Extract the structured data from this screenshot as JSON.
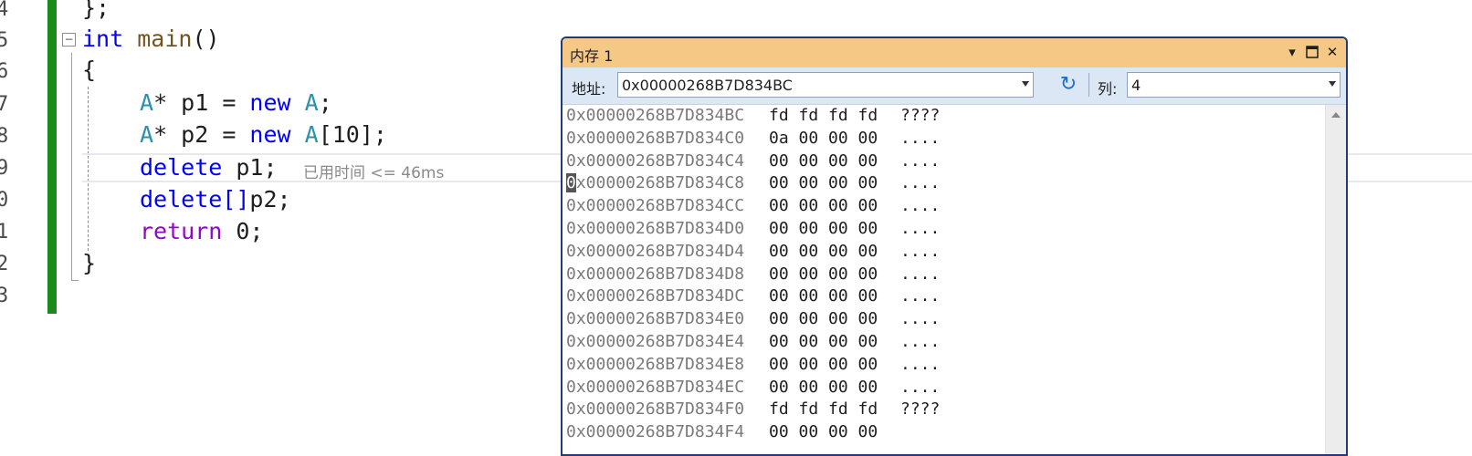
{
  "editor": {
    "line_numbers": [
      "4",
      "5",
      "6",
      "7",
      "8",
      "9",
      "0",
      "1",
      "2",
      "3"
    ],
    "lines": {
      "l4": "};",
      "l5_kw": "int",
      "l5_fn": "main",
      "l5_rest": "()",
      "l6": "{",
      "l7_type": "A",
      "l7_a": "* p1 = ",
      "l7_kw": "new",
      "l7_type2": "A",
      "l7_b": ";",
      "l8_type": "A",
      "l8_a": "* p2 = ",
      "l8_kw": "new",
      "l8_type2": "A",
      "l8_b": "[10];",
      "l9_kw": "delete",
      "l9_rest": " p1;",
      "l10_kw": "delete[]",
      "l10_rest": "p2;",
      "l11_kw": "return",
      "l11_rest": " 0;",
      "l12": "}"
    },
    "perf_tip": "已用时间 <= 46ms"
  },
  "memory_window": {
    "title": "内存 1",
    "address_label": "地址:",
    "address_value": "0x00000268B7D834BC",
    "columns_label": "列:",
    "columns_value": "4",
    "rows": [
      {
        "addr": "0x00000268B7D834BC",
        "bytes": "fd fd fd fd",
        "ascii": "????"
      },
      {
        "addr": "0x00000268B7D834C0",
        "bytes": "0a 00 00 00",
        "ascii": "...."
      },
      {
        "addr": "0x00000268B7D834C4",
        "bytes": "00 00 00 00",
        "ascii": "...."
      },
      {
        "addr": "x00000268B7D834C8",
        "bytes": "00 00 00 00",
        "ascii": "...."
      },
      {
        "addr": "0x00000268B7D834CC",
        "bytes": "00 00 00 00",
        "ascii": "...."
      },
      {
        "addr": "0x00000268B7D834D0",
        "bytes": "00 00 00 00",
        "ascii": "...."
      },
      {
        "addr": "0x00000268B7D834D4",
        "bytes": "00 00 00 00",
        "ascii": "...."
      },
      {
        "addr": "0x00000268B7D834D8",
        "bytes": "00 00 00 00",
        "ascii": "...."
      },
      {
        "addr": "0x00000268B7D834DC",
        "bytes": "00 00 00 00",
        "ascii": "...."
      },
      {
        "addr": "0x00000268B7D834E0",
        "bytes": "00 00 00 00",
        "ascii": "...."
      },
      {
        "addr": "0x00000268B7D834E4",
        "bytes": "00 00 00 00",
        "ascii": "...."
      },
      {
        "addr": "0x00000268B7D834E8",
        "bytes": "00 00 00 00",
        "ascii": "...."
      },
      {
        "addr": "0x00000268B7D834EC",
        "bytes": "00 00 00 00",
        "ascii": "...."
      },
      {
        "addr": "0x00000268B7D834F0",
        "bytes": "fd fd fd fd",
        "ascii": "????"
      },
      {
        "addr": "0x00000268B7D834F4",
        "bytes": "00 00 00 00",
        "ascii": ""
      }
    ],
    "caret_char": "0",
    "icons": {
      "dropdown": "chevron-down-icon",
      "maximize": "maximize-icon",
      "close": "close-icon",
      "refresh": "refresh-icon"
    },
    "colors": {
      "title_bg": "#f5c886",
      "toolbar_bg": "#dce7f5",
      "border": "#1f3b7a"
    }
  }
}
